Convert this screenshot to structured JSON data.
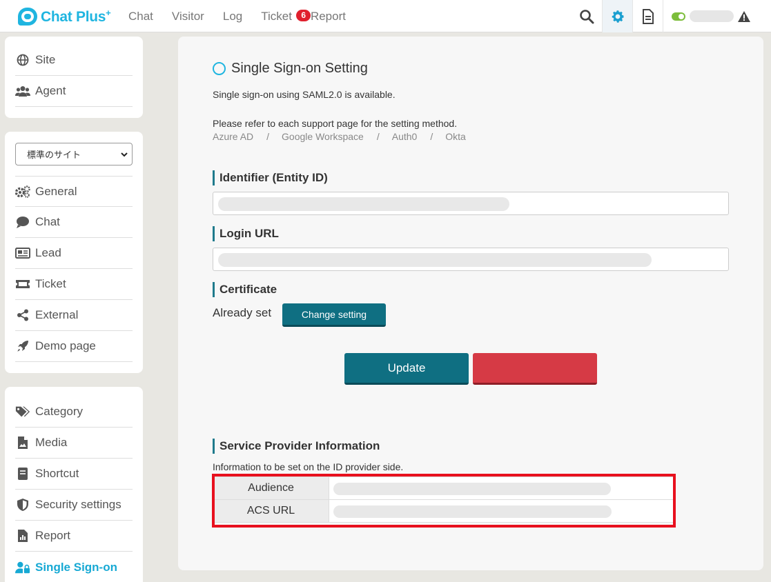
{
  "header": {
    "logo": "Chat Plus",
    "logo_plus": "+",
    "nav": [
      "Chat",
      "Visitor",
      "Log",
      "Ticket",
      "Report"
    ],
    "ticket_badge": "6"
  },
  "sidebar": {
    "group1": [
      "Site",
      "Agent"
    ],
    "site_select": "標準のサイト",
    "group2": [
      "General",
      "Chat",
      "Lead",
      "Ticket",
      "External",
      "Demo page"
    ],
    "group3": [
      "Category",
      "Media",
      "Shortcut",
      "Security settings",
      "Report",
      "Single Sign-on"
    ]
  },
  "main": {
    "title": "Single Sign-on Setting",
    "intro": "Single sign-on using SAML2.0 is available.",
    "refer": "Please refer to each support page for the setting method.",
    "links": [
      "Azure AD",
      "Google Workspace",
      "Auth0",
      "Okta"
    ],
    "link_sep": "/",
    "identifier_label": "Identifier (Entity ID)",
    "login_url_label": "Login URL",
    "certificate_label": "Certificate",
    "already_set": "Already set",
    "change_setting": "Change setting",
    "update": "Update",
    "sp_info_label": "Service Provider Information",
    "sp_info_desc": "Information to be set on the ID provider side.",
    "table": [
      {
        "label": "Audience"
      },
      {
        "label": "ACS URL"
      }
    ]
  },
  "colors": {
    "brand": "#1fb5e0",
    "primary_button": "#0f6f82",
    "danger_button": "#d63a45",
    "highlight": "#e8101e"
  }
}
